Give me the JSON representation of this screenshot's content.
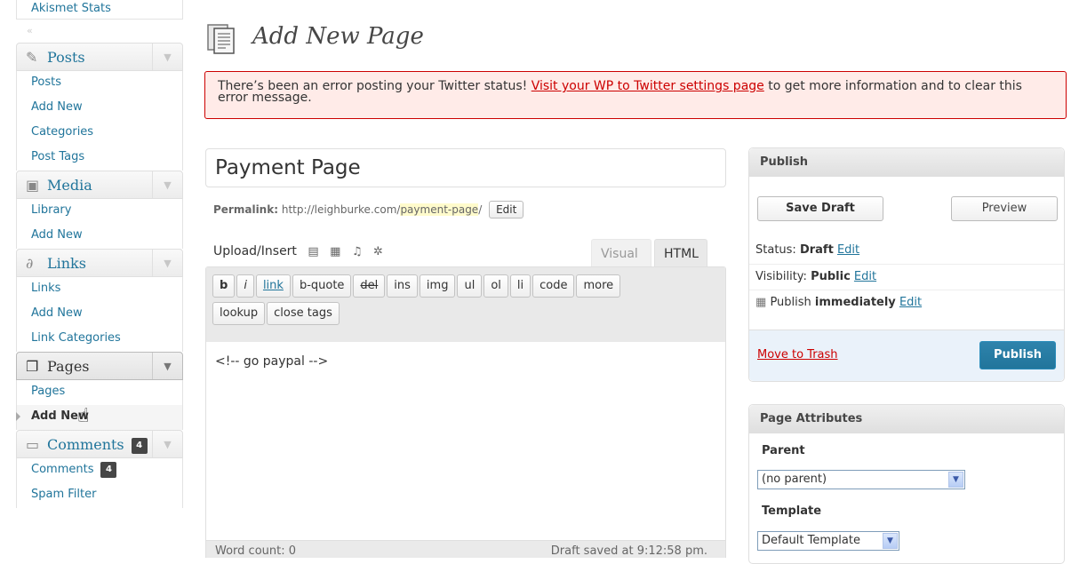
{
  "sidebar": {
    "top_link": "Akismet Stats",
    "collapse_icon": "«",
    "posts": {
      "header": "Posts",
      "items": [
        "Posts",
        "Add New",
        "Categories",
        "Post Tags"
      ]
    },
    "media": {
      "header": "Media",
      "items": [
        "Library",
        "Add New"
      ]
    },
    "links": {
      "header": "Links",
      "items": [
        "Links",
        "Add New",
        "Link Categories"
      ]
    },
    "pages": {
      "header": "Pages",
      "items": [
        "Pages",
        "Add New"
      ]
    },
    "comments": {
      "header": "Comments",
      "badge": "4",
      "items": [
        "Comments",
        "Spam Filter"
      ],
      "item_badge": "4"
    }
  },
  "main": {
    "title": "Add New Page",
    "error": {
      "prefix": "There’s been an error posting your Twitter status! ",
      "link": "Visit your WP to Twitter settings page",
      "suffix": " to get more information and to clear this error message."
    },
    "post_title": "Payment Page",
    "permalink": {
      "label": "Permalink:",
      "base": "http://leighburke.com/",
      "slug": "payment-page",
      "trail": "/",
      "edit": "Edit"
    },
    "upload_insert": "Upload/Insert",
    "tabs": {
      "visual": "Visual",
      "html": "HTML"
    },
    "quicktags": [
      "b",
      "i",
      "link",
      "b-quote",
      "del",
      "ins",
      "img",
      "ul",
      "ol",
      "li",
      "code",
      "more"
    ],
    "quicktags_row2": [
      "lookup",
      "close tags"
    ],
    "content": "<!-- go paypal -->",
    "word_count": "Word count: 0",
    "draft_saved": "Draft saved at 9:12:58 pm."
  },
  "publish": {
    "title": "Publish",
    "save_draft": "Save Draft",
    "preview": "Preview",
    "status_label": "Status: ",
    "status_value": "Draft",
    "visibility_label": "Visibility: ",
    "visibility_value": "Public",
    "publish_label": "Publish ",
    "publish_value": "immediately",
    "edit": "Edit",
    "trash": "Move to Trash",
    "publish_button": "Publish"
  },
  "attributes": {
    "title": "Page Attributes",
    "parent_label": "Parent",
    "parent_value": "(no parent)",
    "template_label": "Template",
    "template_value": "Default Template"
  }
}
